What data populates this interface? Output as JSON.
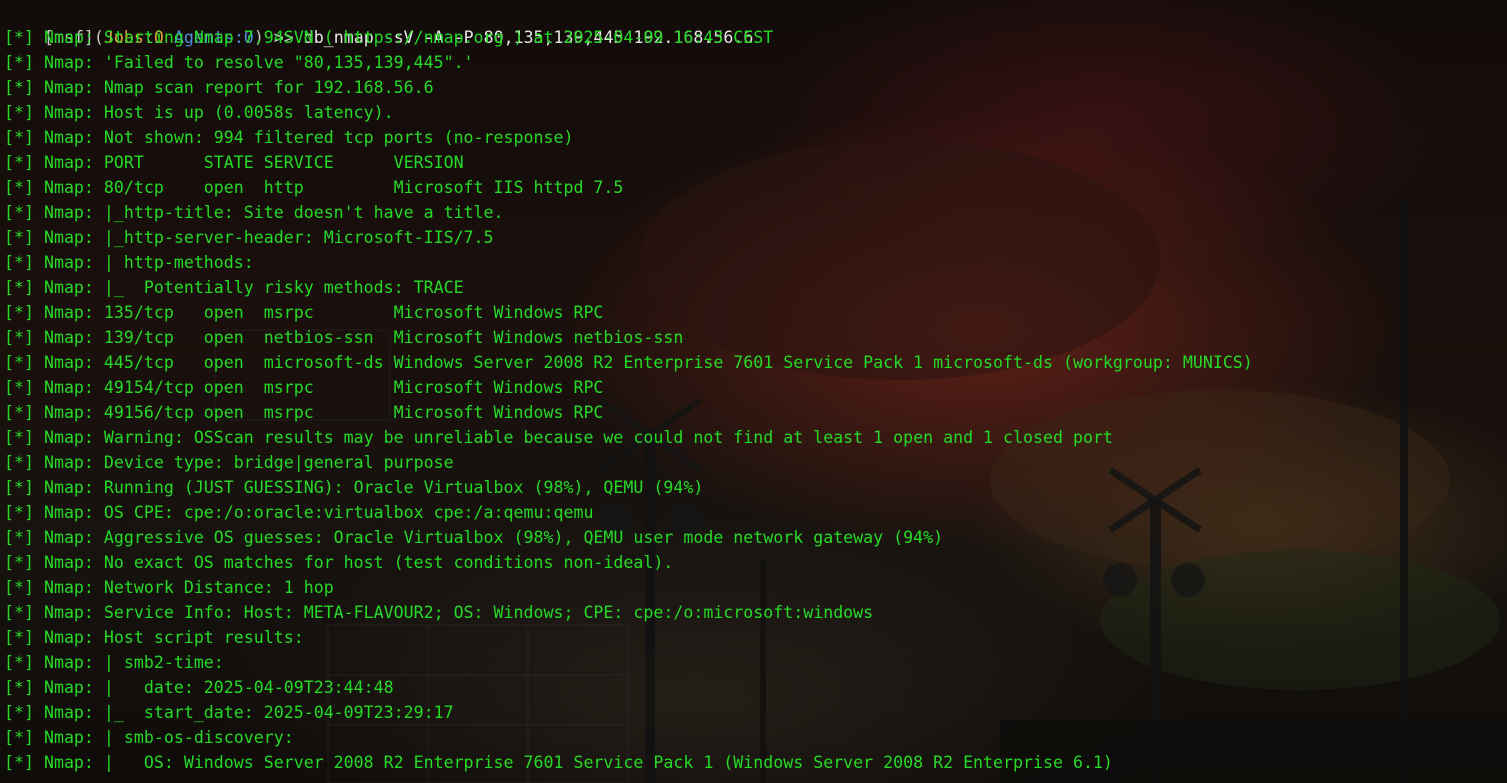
{
  "prompt": {
    "msf": "[msf]",
    "open_paren": "(",
    "jobs": "Jobs:0",
    "space": " ",
    "agents": "Agents:0",
    "close_paren": ")",
    "arrow": " >> ",
    "command": "db_nmap -sV -A -P 80,135,139,445 192.168.56.6"
  },
  "output_prefix": "[*] Nmap: ",
  "output_lines": [
    "Starting Nmap 7.94SVN ( https://nmap.org ) at 2025-04-09 16:43 CEST",
    "'Failed to resolve \"80,135,139,445\".'",
    "Nmap scan report for 192.168.56.6",
    "Host is up (0.0058s latency).",
    "Not shown: 994 filtered tcp ports (no-response)",
    "PORT      STATE SERVICE      VERSION",
    "80/tcp    open  http         Microsoft IIS httpd 7.5",
    "|_http-title: Site doesn't have a title.",
    "|_http-server-header: Microsoft-IIS/7.5",
    "| http-methods:",
    "|_  Potentially risky methods: TRACE",
    "135/tcp   open  msrpc        Microsoft Windows RPC",
    "139/tcp   open  netbios-ssn  Microsoft Windows netbios-ssn",
    "445/tcp   open  microsoft-ds Windows Server 2008 R2 Enterprise 7601 Service Pack 1 microsoft-ds (workgroup: MUNICS)",
    "49154/tcp open  msrpc        Microsoft Windows RPC",
    "49156/tcp open  msrpc        Microsoft Windows RPC",
    "Warning: OSScan results may be unreliable because we could not find at least 1 open and 1 closed port",
    "Device type: bridge|general purpose",
    "Running (JUST GUESSING): Oracle Virtualbox (98%), QEMU (94%)",
    "OS CPE: cpe:/o:oracle:virtualbox cpe:/a:qemu:qemu",
    "Aggressive OS guesses: Oracle Virtualbox (98%), QEMU user mode network gateway (94%)",
    "No exact OS matches for host (test conditions non-ideal).",
    "Network Distance: 1 hop",
    "Service Info: Host: META-FLAVOUR2; OS: Windows; CPE: cpe:/o:microsoft:windows",
    "Host script results:",
    "| smb2-time:",
    "|   date: 2025-04-09T23:44:48",
    "|_  start_date: 2025-04-09T23:29:17",
    "| smb-os-discovery:",
    "|   OS: Windows Server 2008 R2 Enterprise 7601 Service Pack 1 (Windows Server 2008 R2 Enterprise 6.1)"
  ],
  "colors": {
    "output_green": "#26d926",
    "jobs_orange": "#e0a83c",
    "agents_blue": "#4f8fd8",
    "prompt_gray": "#c7c7c7",
    "command_white": "#e6e6e6"
  }
}
